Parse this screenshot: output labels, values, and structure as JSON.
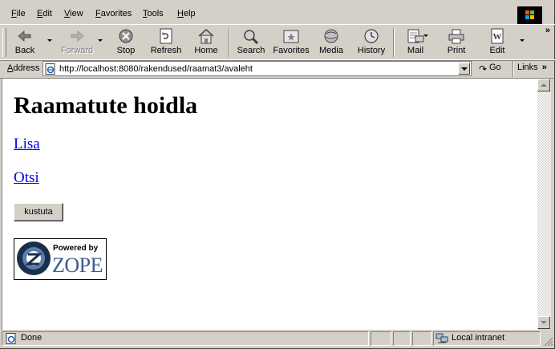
{
  "menu": {
    "items": [
      "File",
      "Edit",
      "View",
      "Favorites",
      "Tools",
      "Help"
    ]
  },
  "toolbar": {
    "buttons": [
      {
        "label": "Back",
        "icon": "back-arrow-icon",
        "enabled": true
      },
      {
        "label": "Forward",
        "icon": "forward-arrow-icon",
        "enabled": false
      },
      {
        "label": "Stop",
        "icon": "stop-icon",
        "enabled": true
      },
      {
        "label": "Refresh",
        "icon": "refresh-icon",
        "enabled": true
      },
      {
        "label": "Home",
        "icon": "home-icon",
        "enabled": true
      },
      {
        "label": "Search",
        "icon": "search-icon",
        "enabled": true
      },
      {
        "label": "Favorites",
        "icon": "favorites-icon",
        "enabled": true
      },
      {
        "label": "Media",
        "icon": "media-icon",
        "enabled": true
      },
      {
        "label": "History",
        "icon": "history-icon",
        "enabled": true
      },
      {
        "label": "Mail",
        "icon": "mail-icon",
        "enabled": true
      },
      {
        "label": "Print",
        "icon": "print-icon",
        "enabled": true
      },
      {
        "label": "Edit",
        "icon": "edit-icon",
        "enabled": true
      }
    ],
    "more": "»"
  },
  "address": {
    "label": "Address",
    "url": "http://localhost:8080/rakendused/raamat3/avaleht",
    "go_label": "Go",
    "links_label": "Links",
    "links_more": "»"
  },
  "page": {
    "title": "Raamatute hoidla",
    "links": [
      "Lisa",
      "Otsi"
    ],
    "button_label": "kustuta",
    "logo": {
      "powered_text": "Powered by",
      "brand_text": "ZOPE"
    }
  },
  "status": {
    "text": "Done",
    "zone": "Local intranet"
  },
  "colors": {
    "chrome": "#d4d0c8",
    "link": "#0000ee",
    "zope_blue": "#3b5d8c"
  }
}
